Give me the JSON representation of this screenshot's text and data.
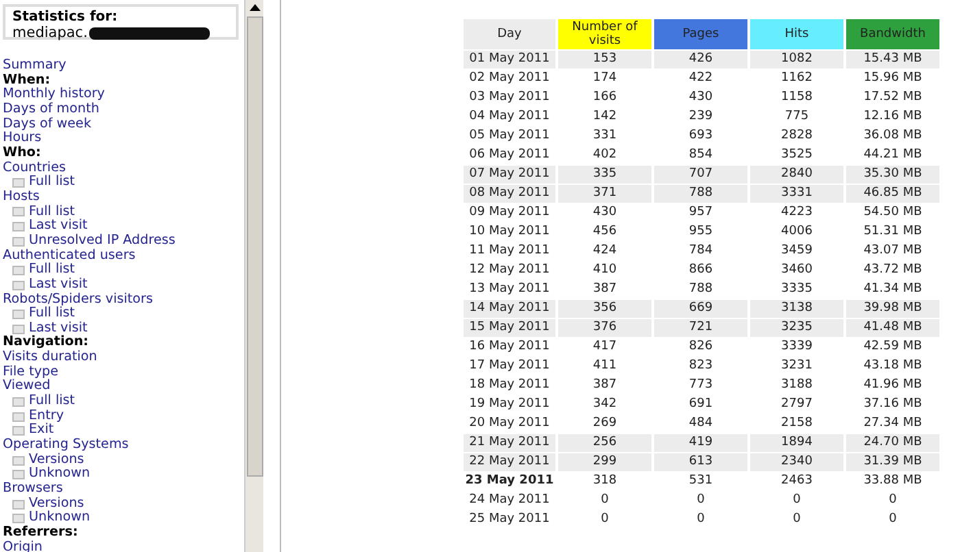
{
  "sidebar": {
    "header": {
      "label": "Statistics for:",
      "site": "mediapac.",
      "redacted": true
    },
    "items": [
      {
        "kind": "link",
        "text": "Summary"
      },
      {
        "kind": "heading",
        "text": "When:"
      },
      {
        "kind": "link",
        "text": "Monthly history"
      },
      {
        "kind": "link",
        "text": "Days of month"
      },
      {
        "kind": "link",
        "text": "Days of week"
      },
      {
        "kind": "link",
        "text": "Hours"
      },
      {
        "kind": "heading",
        "text": "Who:"
      },
      {
        "kind": "link",
        "text": "Countries",
        "children": [
          {
            "text": "Full list"
          }
        ]
      },
      {
        "kind": "link",
        "text": "Hosts",
        "children": [
          {
            "text": "Full list"
          },
          {
            "text": "Last visit"
          },
          {
            "text": "Unresolved IP Address"
          }
        ]
      },
      {
        "kind": "link",
        "text": "Authenticated users",
        "children": [
          {
            "text": "Full list"
          },
          {
            "text": "Last visit"
          }
        ]
      },
      {
        "kind": "link",
        "text": "Robots/Spiders visitors",
        "children": [
          {
            "text": "Full list"
          },
          {
            "text": "Last visit"
          }
        ]
      },
      {
        "kind": "heading",
        "text": "Navigation:"
      },
      {
        "kind": "link",
        "text": "Visits duration"
      },
      {
        "kind": "link",
        "text": "File type"
      },
      {
        "kind": "link",
        "text": "Viewed",
        "children": [
          {
            "text": "Full list"
          },
          {
            "text": "Entry"
          },
          {
            "text": "Exit"
          }
        ]
      },
      {
        "kind": "link",
        "text": "Operating Systems",
        "children": [
          {
            "text": "Versions"
          },
          {
            "text": "Unknown"
          }
        ]
      },
      {
        "kind": "link",
        "text": "Browsers",
        "children": [
          {
            "text": "Versions"
          },
          {
            "text": "Unknown"
          }
        ]
      },
      {
        "kind": "heading",
        "text": "Referrers:"
      },
      {
        "kind": "link",
        "text": "Origin"
      }
    ]
  },
  "table": {
    "columns": [
      {
        "label": "Day",
        "color": "#ececec"
      },
      {
        "label": "Number of visits",
        "color": "#ffff00"
      },
      {
        "label": "Pages",
        "color": "#4477dd"
      },
      {
        "label": "Hits",
        "color": "#66eeff"
      },
      {
        "label": "Bandwidth",
        "color": "#2ea03e"
      }
    ],
    "rows": [
      {
        "cells": [
          "01 May 2011",
          "153",
          "426",
          "1082",
          "15.43 MB"
        ],
        "weekend": true,
        "today": false
      },
      {
        "cells": [
          "02 May 2011",
          "174",
          "422",
          "1162",
          "15.96 MB"
        ],
        "weekend": false,
        "today": false
      },
      {
        "cells": [
          "03 May 2011",
          "166",
          "430",
          "1158",
          "17.52 MB"
        ],
        "weekend": false,
        "today": false
      },
      {
        "cells": [
          "04 May 2011",
          "142",
          "239",
          "775",
          "12.16 MB"
        ],
        "weekend": false,
        "today": false
      },
      {
        "cells": [
          "05 May 2011",
          "331",
          "693",
          "2828",
          "36.08 MB"
        ],
        "weekend": false,
        "today": false
      },
      {
        "cells": [
          "06 May 2011",
          "402",
          "854",
          "3525",
          "44.21 MB"
        ],
        "weekend": false,
        "today": false
      },
      {
        "cells": [
          "07 May 2011",
          "335",
          "707",
          "2840",
          "35.30 MB"
        ],
        "weekend": true,
        "today": false
      },
      {
        "cells": [
          "08 May 2011",
          "371",
          "788",
          "3331",
          "46.85 MB"
        ],
        "weekend": true,
        "today": false
      },
      {
        "cells": [
          "09 May 2011",
          "430",
          "957",
          "4223",
          "54.50 MB"
        ],
        "weekend": false,
        "today": false
      },
      {
        "cells": [
          "10 May 2011",
          "456",
          "955",
          "4006",
          "51.31 MB"
        ],
        "weekend": false,
        "today": false
      },
      {
        "cells": [
          "11 May 2011",
          "424",
          "784",
          "3459",
          "43.07 MB"
        ],
        "weekend": false,
        "today": false
      },
      {
        "cells": [
          "12 May 2011",
          "410",
          "866",
          "3460",
          "43.72 MB"
        ],
        "weekend": false,
        "today": false
      },
      {
        "cells": [
          "13 May 2011",
          "387",
          "788",
          "3335",
          "41.34 MB"
        ],
        "weekend": false,
        "today": false
      },
      {
        "cells": [
          "14 May 2011",
          "356",
          "669",
          "3138",
          "39.98 MB"
        ],
        "weekend": true,
        "today": false
      },
      {
        "cells": [
          "15 May 2011",
          "376",
          "721",
          "3235",
          "41.48 MB"
        ],
        "weekend": true,
        "today": false
      },
      {
        "cells": [
          "16 May 2011",
          "417",
          "826",
          "3339",
          "42.59 MB"
        ],
        "weekend": false,
        "today": false
      },
      {
        "cells": [
          "17 May 2011",
          "411",
          "823",
          "3231",
          "43.18 MB"
        ],
        "weekend": false,
        "today": false
      },
      {
        "cells": [
          "18 May 2011",
          "387",
          "773",
          "3188",
          "41.96 MB"
        ],
        "weekend": false,
        "today": false
      },
      {
        "cells": [
          "19 May 2011",
          "342",
          "691",
          "2797",
          "37.16 MB"
        ],
        "weekend": false,
        "today": false
      },
      {
        "cells": [
          "20 May 2011",
          "269",
          "484",
          "2158",
          "27.34 MB"
        ],
        "weekend": false,
        "today": false
      },
      {
        "cells": [
          "21 May 2011",
          "256",
          "419",
          "1894",
          "24.70 MB"
        ],
        "weekend": true,
        "today": false
      },
      {
        "cells": [
          "22 May 2011",
          "299",
          "613",
          "2340",
          "31.39 MB"
        ],
        "weekend": true,
        "today": false
      },
      {
        "cells": [
          "23 May 2011",
          "318",
          "531",
          "2463",
          "33.88 MB"
        ],
        "weekend": false,
        "today": true
      },
      {
        "cells": [
          "24 May 2011",
          "0",
          "0",
          "0",
          "0"
        ],
        "weekend": false,
        "today": false
      },
      {
        "cells": [
          "25 May 2011",
          "0",
          "0",
          "0",
          "0"
        ],
        "weekend": false,
        "today": false
      }
    ]
  }
}
